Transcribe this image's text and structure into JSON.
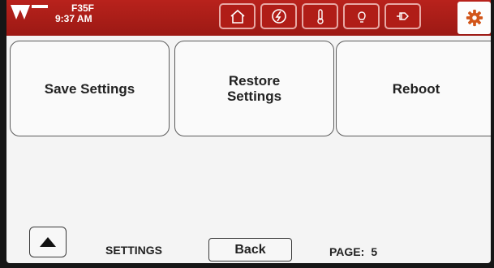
{
  "header": {
    "device_name": "F35F",
    "time": "9:37 AM",
    "icons": [
      "home-icon",
      "energy-icon",
      "thermometer-icon",
      "lightbulb-icon",
      "plug-icon",
      "gear-icon"
    ]
  },
  "buttons": {
    "save": "Save Settings",
    "restore_line1": "Restore",
    "restore_line2": "Settings",
    "reboot": "Reboot"
  },
  "footer": {
    "section_label": "SETTINGS",
    "back_label": "Back",
    "page_label": "PAGE:",
    "page_number": "5"
  },
  "colors": {
    "header_red": "#b01d17",
    "screen_bg": "#f4f4f4",
    "gear_orange": "#d2561a"
  }
}
